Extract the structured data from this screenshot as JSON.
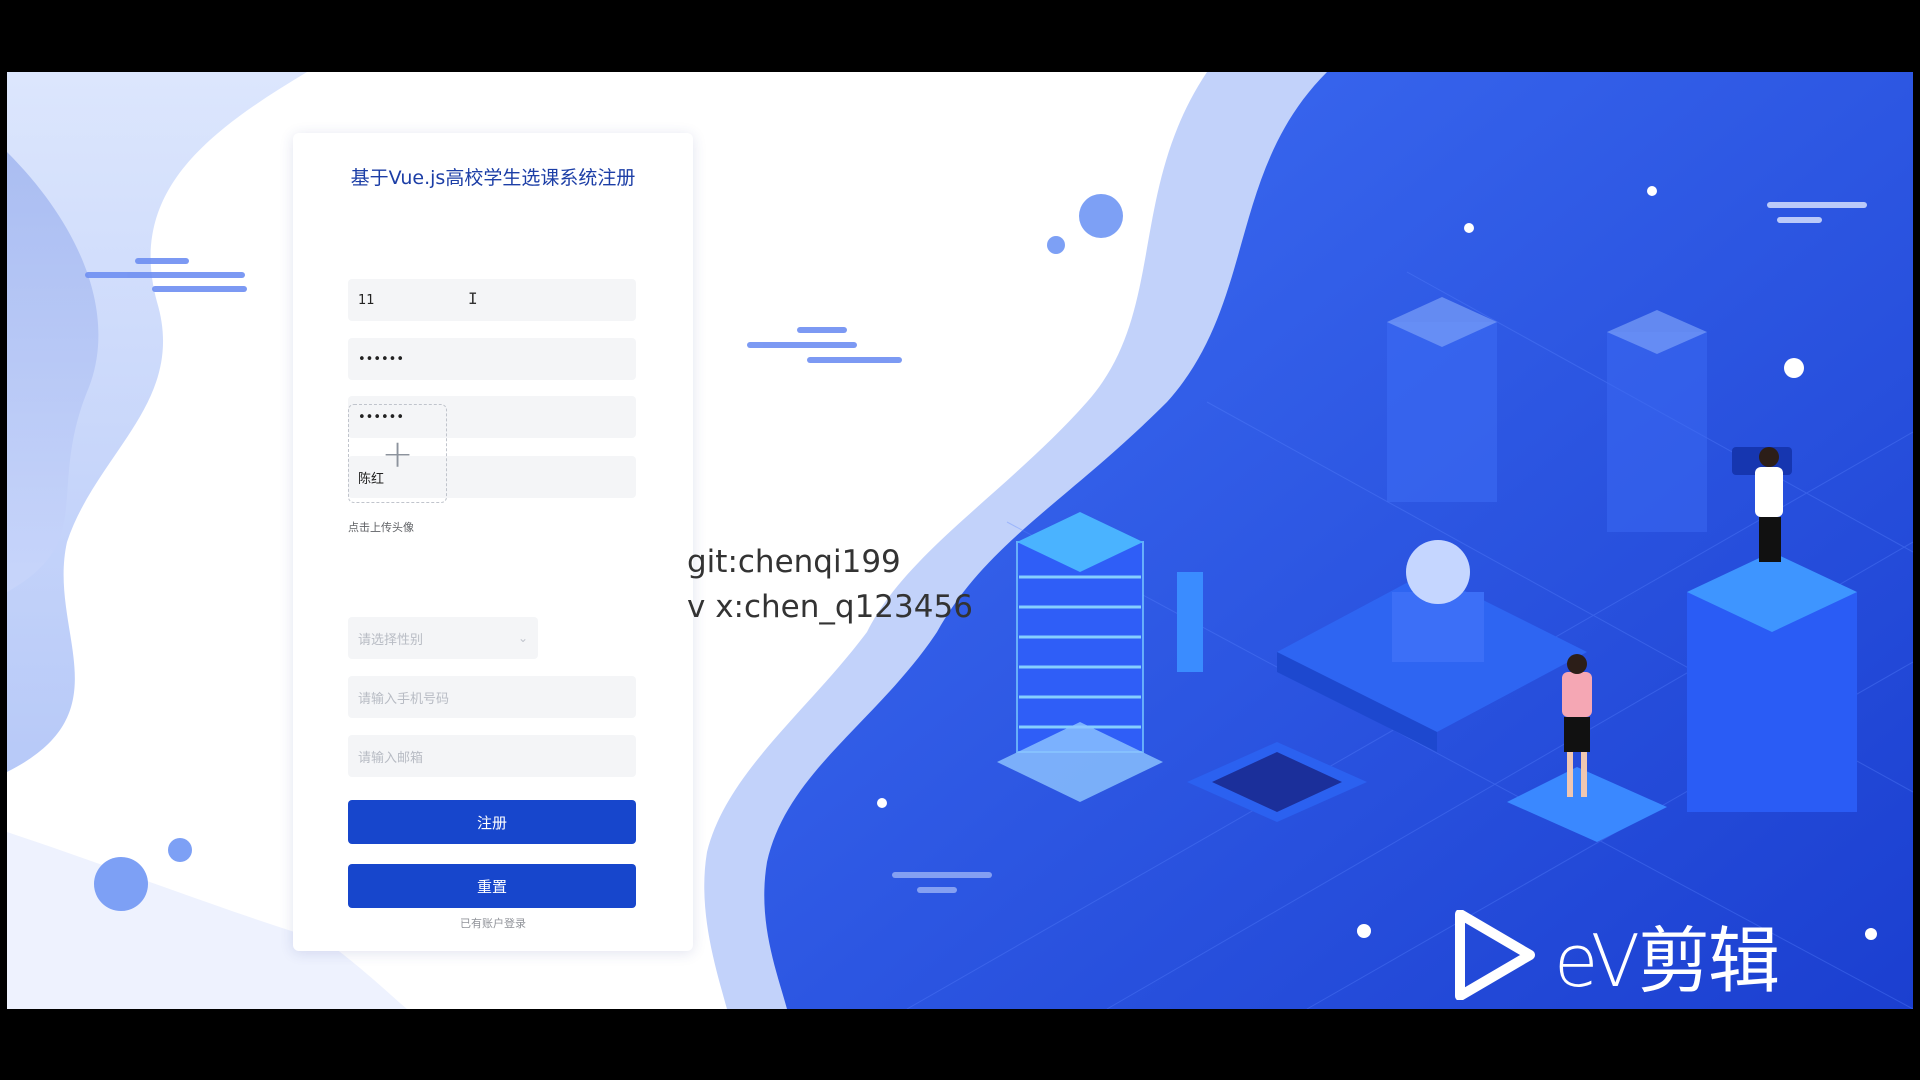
{
  "form": {
    "title": "基于Vue.js高校学生选课系统注册",
    "username_value": "11",
    "password_value": "••••••",
    "confirm_password_value": "••••••",
    "name_value": "陈红",
    "upload_icon": "plus-icon",
    "upload_hint": "点击上传头像",
    "gender_placeholder": "请选择性别",
    "phone_placeholder": "请输入手机号码",
    "email_placeholder": "请输入邮箱",
    "register_label": "注册",
    "reset_label": "重置",
    "login_link": "已有账户登录"
  },
  "overlay": {
    "line1": "git:chenqi199",
    "line2": "v x:chen_q123456"
  },
  "watermark": {
    "icon": "play-icon",
    "text": "eV剪辑"
  },
  "colors": {
    "primary": "#1746cc",
    "title": "#1c3ea6",
    "background_blue": "#2a5cf0",
    "light_blue": "#cfdcfb"
  }
}
